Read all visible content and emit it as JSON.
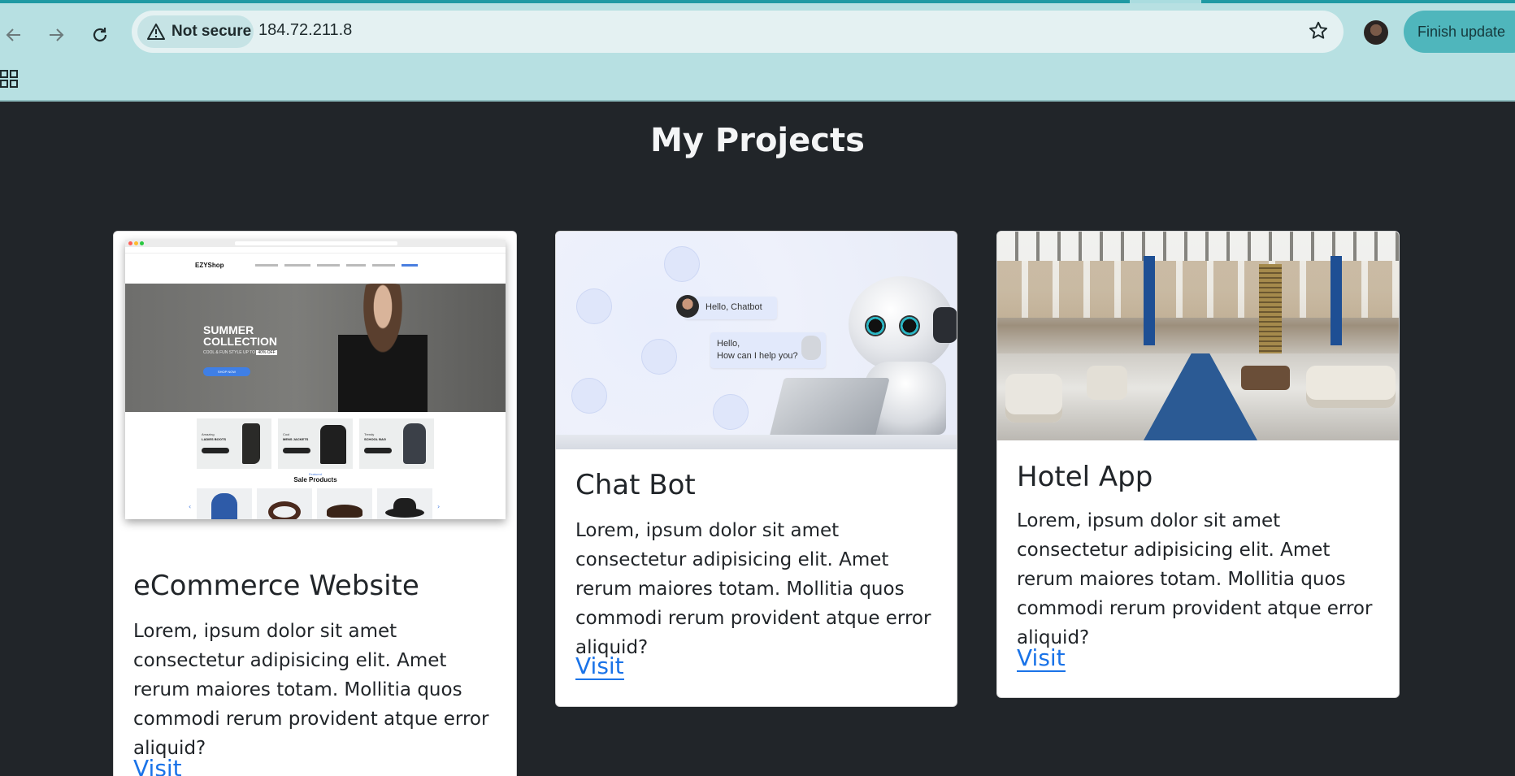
{
  "browser": {
    "security_label": "Not secure",
    "url": "184.72.211.8",
    "finish_update_label": "Finish update",
    "icons": {
      "back": "back-arrow-icon",
      "forward": "forward-arrow-icon",
      "reload": "reload-icon",
      "warning": "warning-icon",
      "bookmark": "star-icon",
      "apps": "apps-grid-icon"
    },
    "colors": {
      "chrome": "#b7e0e2",
      "accent": "#4fb6bc"
    }
  },
  "page": {
    "title": "My Projects",
    "background": "#212529"
  },
  "projects": [
    {
      "title": "eCommerce Website",
      "description": "Lorem, ipsum dolor sit amet consectetur adipisicing elit. Amet rerum maiores totam. Mollitia quos commodi rerum provident atque error aliquid?",
      "link_label": "Visit",
      "preview": {
        "brand": "EZYShop",
        "hero_line1": "SUMMER",
        "hero_line2": "COLLECTION",
        "hero_sub": "COOL & FUN STYLE UP TO",
        "hero_badge": "40% OFF",
        "shop_btn": "SHOP NOW",
        "promo1_small": "Amazing",
        "promo1_big": "LADIES BOOTS",
        "promo2_small": "Cool",
        "promo2_big": "MENS JACKETS",
        "promo3_small": "Trendy",
        "promo3_big": "SCHOOL BAG",
        "section_small": "Featured",
        "section_title": "Sale Products"
      }
    },
    {
      "title": "Chat Bot",
      "description": "Lorem, ipsum dolor sit amet consectetur adipisicing elit. Amet rerum maiores totam. Mollitia quos commodi rerum provident atque error aliquid?",
      "link_label": "Visit",
      "preview": {
        "bubble1": "Hello, Chatbot",
        "bubble2_line1": "Hello,",
        "bubble2_line2": "How can I help you?"
      }
    },
    {
      "title": "Hotel App",
      "description": "Lorem, ipsum dolor sit amet consectetur adipisicing elit. Amet rerum maiores totam. Mollitia quos commodi rerum provident atque error aliquid?",
      "link_label": "Visit"
    }
  ]
}
